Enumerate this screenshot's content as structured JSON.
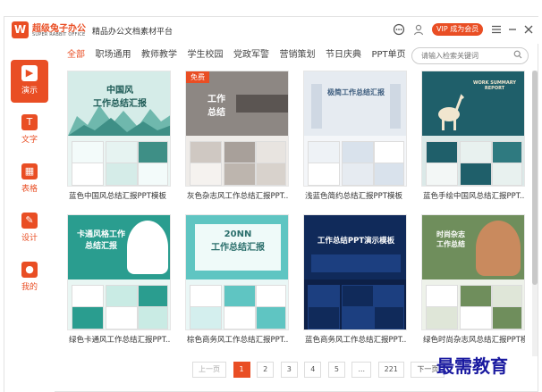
{
  "app": {
    "logo_char": "W",
    "name": "超级兔子办公",
    "name_en": "SUPER RABBIT OFFICE",
    "slogan": "精品办公文档素材平台",
    "vip_label": "VIP 成为会员"
  },
  "titlebar_icons": [
    "message-icon",
    "user-icon",
    "menu-icon",
    "minimize-icon",
    "close-icon"
  ],
  "sidebar": {
    "items": [
      {
        "label": "演示",
        "icon": "presentation-icon",
        "glyph": "▶",
        "active": true
      },
      {
        "label": "文字",
        "icon": "text-doc-icon",
        "glyph": "T",
        "active": false
      },
      {
        "label": "表格",
        "icon": "spreadsheet-icon",
        "glyph": "▦",
        "active": false
      },
      {
        "label": "设计",
        "icon": "design-icon",
        "glyph": "✎",
        "active": false
      },
      {
        "label": "我的",
        "icon": "profile-icon",
        "glyph": "●",
        "active": false
      }
    ]
  },
  "tabs": [
    "全部",
    "职场通用",
    "教师教学",
    "学生校园",
    "党政军警",
    "营销策划",
    "节日庆典",
    "PPT单页"
  ],
  "active_tab": "全部",
  "search": {
    "placeholder": "请输入检索关键词"
  },
  "free_badge": "免费",
  "cards": [
    {
      "title": "蓝色中国风总结汇报PPT模板",
      "slide_title": "中国风\n工作总结汇报",
      "theme": "#a8d8d0"
    },
    {
      "title": "灰色杂志风工作总结汇报PPT...",
      "slide_title": "工作\n总结",
      "theme": "#b9b0a8",
      "free": true
    },
    {
      "title": "浅蓝色简约总结汇报PPT模板",
      "slide_title": "极简工作总结汇报",
      "theme": "#dfe6ee"
    },
    {
      "title": "蓝色手绘中国风总结汇报PPT...",
      "slide_title": "WORK SUMMARY REPORT",
      "theme": "#1f5f6a"
    },
    {
      "title": "绿色卡通风工作总结汇报PPT...",
      "slide_title": "卡通风格工作\n总结汇报",
      "theme": "#2a9d8f"
    },
    {
      "title": "棕色商务风工作总结汇报PPT...",
      "slide_title": "20NN\n工作总结汇报",
      "theme": "#5fc5c2"
    },
    {
      "title": "蓝色商务风工作总结汇报PPT...",
      "slide_title": "工作总结PPT演示模板",
      "theme": "#102a5a"
    },
    {
      "title": "绿色时尚杂志风总结汇报PPT模板",
      "slide_title": "时尚杂志\n工作总结",
      "theme": "#6f8e5c"
    }
  ],
  "pagination": {
    "prev": "上一页",
    "pages": [
      "1",
      "2",
      "3",
      "4",
      "5",
      "...",
      "221"
    ],
    "active": "1",
    "next": "下一页"
  },
  "watermark": "最需教育"
}
